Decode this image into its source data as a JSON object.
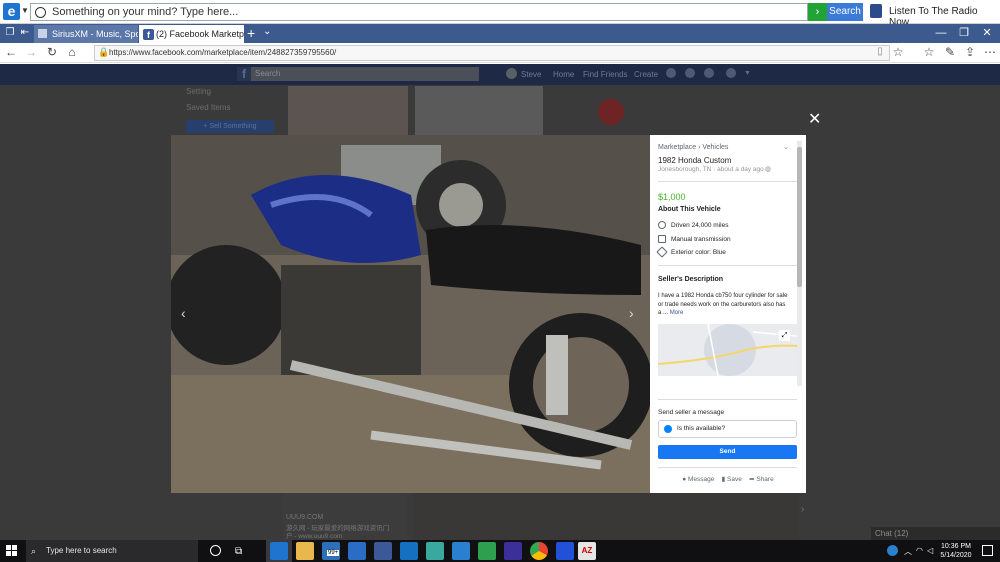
{
  "toolbar": {
    "search_placeholder": "Something on your mind? Type here...",
    "search_button": "Search",
    "radio_label": "Listen To The Radio Now"
  },
  "tabs": [
    {
      "title": "SiriusXM - Music, Sport"
    },
    {
      "title": "(2) Facebook Marketpla"
    }
  ],
  "address": {
    "url": "https://www.facebook.com/marketplace/item/248827359795560/"
  },
  "facebook_header": {
    "search_placeholder": "Search",
    "nav": [
      "Steve",
      "Home",
      "Find Friends",
      "Create"
    ]
  },
  "background": {
    "sidebar_items": [
      "Setting",
      "Saved Items"
    ],
    "sell_button": "+ Sell Something",
    "ad_lines": [
      "UUU9.COM",
      "游久网 - 玩家最爱的网络游戏资讯门",
      "户 - www.uuu9.com"
    ],
    "chat_label": "Chat (12)"
  },
  "listing": {
    "breadcrumb": "Marketplace › Vehicles",
    "title": "1982 Honda Custom",
    "location_time": "Jonesborough, TN · about a day ago",
    "price": "$1,000",
    "about_heading": "About This Vehicle",
    "features": [
      "Driven 24,000 miles",
      "Manual transmission",
      "Exterior color: Blue"
    ],
    "seller_desc_heading": "Seller's Description",
    "seller_desc": "I have a 1982 Honda cb750 four cylinder for sale or trade needs work on the carburetors also has a ...",
    "more_link": "More",
    "send_message_label": "Send seller a message",
    "message_input": "Is this available?",
    "send_button": "Send",
    "actions": [
      "Message",
      "Save",
      "Share"
    ]
  },
  "taskbar": {
    "search_placeholder": "Type here to search",
    "mail_badge": "99+",
    "time": "10:36 PM",
    "date": "5/14/2020"
  },
  "colors": {
    "facebook_blue": "#1877f2",
    "price_green": "#42b72a",
    "tabstrip": "#3c5a8e"
  }
}
